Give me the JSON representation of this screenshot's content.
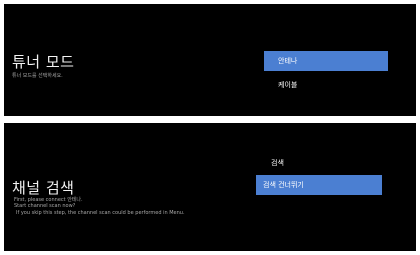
{
  "tuner_screen": {
    "title": "튜너 모드",
    "subtitle": "튜너 모드를 선택하세요.",
    "options": [
      {
        "label": "안테나",
        "selected": true
      },
      {
        "label": "케이블",
        "selected": false
      }
    ]
  },
  "scan_screen": {
    "title": "채널 검색",
    "description": [
      "First, please connect 안테나.",
      "Start channel scan now?",
      "If you skip this step, the channel scan could be performed in Menu."
    ],
    "options": [
      {
        "label": "검색",
        "selected": false
      },
      {
        "label": "검색 건너뛰기",
        "selected": true
      }
    ]
  },
  "colors": {
    "background": "#000000",
    "highlight": "#4b7fd2",
    "secondary_text": "#a7a7a7"
  }
}
